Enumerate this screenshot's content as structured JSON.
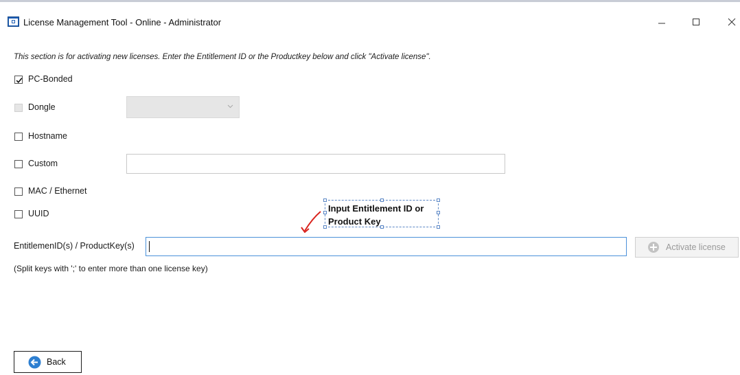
{
  "window": {
    "title": "License Management Tool - Online - Administrator",
    "minimize_icon": "minimize-icon",
    "maximize_icon": "maximize-icon",
    "close_icon": "close-icon"
  },
  "instruction": "This section is for activating new licenses. Enter the Entitlement ID or the Productkey below and click \"Activate license\".",
  "options": [
    {
      "label": "PC-Bonded",
      "checked": true,
      "enabled": true
    },
    {
      "label": "Dongle",
      "checked": false,
      "enabled": false
    },
    {
      "label": "Hostname",
      "checked": false,
      "enabled": true
    },
    {
      "label": "Custom",
      "checked": false,
      "enabled": true
    },
    {
      "label": "MAC / Ethernet",
      "checked": false,
      "enabled": true
    },
    {
      "label": "UUID",
      "checked": false,
      "enabled": true
    }
  ],
  "dongle_select": {
    "value": ""
  },
  "custom_input": {
    "value": ""
  },
  "annotation": {
    "text": "Input Entitlement ID or\nProduct Key",
    "arrow_color": "#d9231d"
  },
  "key_field": {
    "label": "EntitlemenID(s) / ProductKey(s)",
    "value": ""
  },
  "activate_button": {
    "label": "Activate license",
    "icon": "plus-circle-icon"
  },
  "hint": "(Split keys with ';' to enter more than one license key)",
  "back_button": {
    "label": "Back",
    "icon": "back-arrow-icon"
  },
  "colors": {
    "accent": "#2d7fd1",
    "focus_border": "#4a90d9",
    "disabled_text": "#9a9a9a"
  }
}
